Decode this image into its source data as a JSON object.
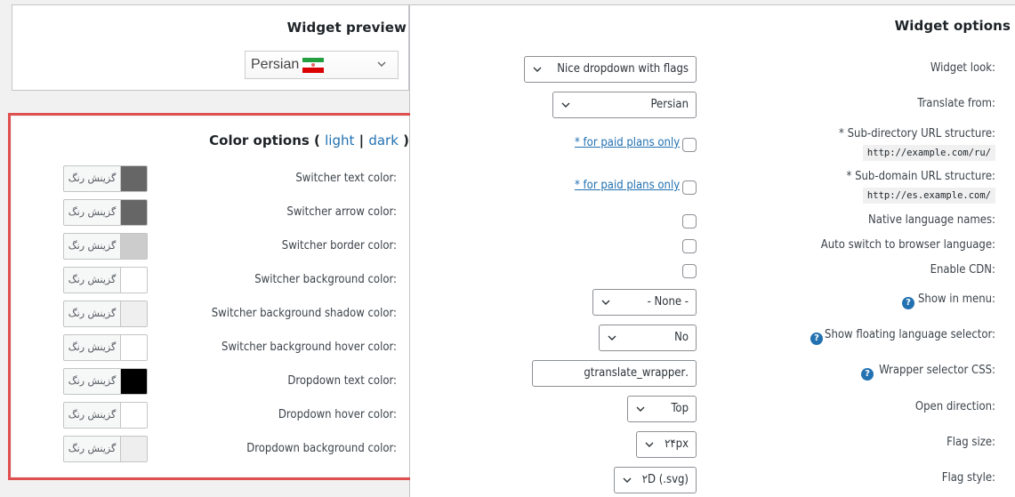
{
  "preview": {
    "title": "Widget preview",
    "selected_language": "Persian",
    "flag_icon": "iran-flag-icon"
  },
  "color_options": {
    "title": "Color options (",
    "light_link": "light",
    "separator": "|",
    "dark_link": "dark",
    "close_paren": ")",
    "button_text": "گزینش رنگ",
    "rows": [
      {
        "label": "Switcher text color:",
        "color": "#666666"
      },
      {
        "label": "Switcher arrow color:",
        "color": "#666666"
      },
      {
        "label": "Switcher border color:",
        "color": "#cccccc"
      },
      {
        "label": "Switcher background color:",
        "color": "#ffffff"
      },
      {
        "label": "Switcher background shadow color:",
        "color": "#efefef"
      },
      {
        "label": "Switcher background hover color:",
        "color": "#ffffff"
      },
      {
        "label": "Dropdown text color:",
        "color": "#000000"
      },
      {
        "label": "Dropdown hover color:",
        "color": "#ffffff"
      },
      {
        "label": "Dropdown background color:",
        "color": "#eeeeee"
      }
    ]
  },
  "widget_options": {
    "title": "Widget options",
    "widget_look": {
      "label": "Widget look:",
      "value": "Nice dropdown with flags"
    },
    "translate_from": {
      "label": "Translate from:",
      "value": "Persian"
    },
    "sub_directory": {
      "label": "* Sub-directory URL structure:",
      "example": "http://example.com/ru/",
      "link": "* for paid plans only"
    },
    "sub_domain": {
      "label": "* Sub-domain URL structure:",
      "example": "http://es.example.com/",
      "link": "* for paid plans only"
    },
    "native_names": {
      "label": "Native language names:"
    },
    "auto_switch": {
      "label": "Auto switch to browser language:"
    },
    "enable_cdn": {
      "label": "Enable CDN:"
    },
    "show_in_menu": {
      "label": "Show in menu:",
      "value": "- None -"
    },
    "floating_selector": {
      "label": "Show floating language selector:",
      "value": "No"
    },
    "wrapper_css": {
      "label": "Wrapper selector CSS:",
      "value": ".gtranslate_wrapper"
    },
    "open_direction": {
      "label": "Open direction:",
      "value": "Top"
    },
    "flag_size": {
      "label": "Flag size:",
      "value": "۲۴px"
    },
    "flag_style": {
      "label": "Flag style:",
      "value": "۲D (.svg)"
    },
    "help_glyph": "?"
  },
  "colors": {
    "accent": "#2271b1",
    "highlight_border": "#e04f4f"
  }
}
